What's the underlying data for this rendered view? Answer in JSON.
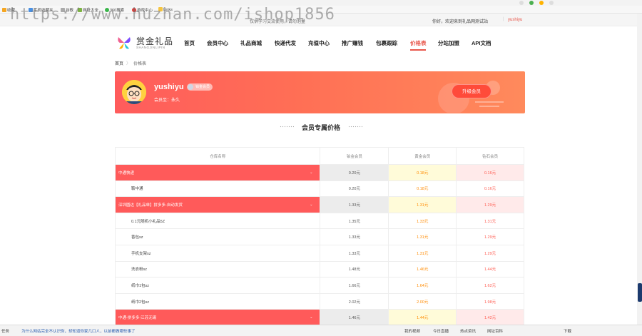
{
  "watermark": "https://www.huzhan.com/ishop1856",
  "bookmarks": [
    {
      "label": "收藏",
      "color": "#f5a623"
    },
    {
      "label": "手机收藏夹",
      "color": "#4a90e2"
    },
    {
      "label": "谷歌",
      "color": "#888888"
    },
    {
      "label": "网址大全",
      "color": "#7cb342"
    },
    {
      "label": "360搜索",
      "color": "#3ab54a"
    },
    {
      "label": "游戏中心",
      "color": "#e53935"
    },
    {
      "label": "Links",
      "color": "#f5c542"
    }
  ],
  "topbar": {
    "notice": "仅供学习交流使用，请勿泡量",
    "welcome": "你好，欢迎来到礼品网测试站",
    "separator": "|",
    "username": "yushiyu"
  },
  "header": {
    "logo_name": "赏金礼品",
    "logo_sub": "SHANGJINLIPIN",
    "nav": [
      "首页",
      "会员中心",
      "礼品商城",
      "快递代发",
      "充值中心",
      "推广赚钱",
      "包裹跟踪",
      "价格表",
      "分站加盟",
      "API文档"
    ],
    "active_nav": "价格表"
  },
  "breadcrumb": {
    "home": "首页",
    "sep": "〉",
    "current": "价格表"
  },
  "banner": {
    "username": "yushiyu",
    "badge": "铂金会员",
    "level_label": "会员至：永久",
    "upgrade_button": "升级会员"
  },
  "section_title": "会员专属价格",
  "table": {
    "headers": [
      "仓库名称",
      "铂金会员",
      "黄金会员",
      "钻石会员"
    ],
    "rows": [
      {
        "type": "group",
        "name": "中通快递",
        "silver": "0.20元",
        "gold": "0.18元",
        "diamond": "0.16元"
      },
      {
        "type": "item",
        "name": "鞍中通",
        "silver": "0.20元",
        "gold": "0.18元",
        "diamond": "0.16元"
      },
      {
        "type": "group",
        "name": "深圳圆达【礼品单】拼多多-自动发货",
        "silver": "1.33元",
        "gold": "1.31元",
        "diamond": "1.29元"
      },
      {
        "type": "item",
        "name": "0.1元随机小礼品5Z",
        "silver": "1.35元",
        "gold": "1.33元",
        "diamond": "1.31元"
      },
      {
        "type": "item",
        "name": "香包sz",
        "silver": "1.33元",
        "gold": "1.31元",
        "diamond": "1.29元"
      },
      {
        "type": "item",
        "name": "手机支架sz",
        "silver": "1.33元",
        "gold": "1.31元",
        "diamond": "1.29元"
      },
      {
        "type": "item",
        "name": "洗衣粉sz",
        "silver": "1.48元",
        "gold": "1.46元",
        "diamond": "1.44元"
      },
      {
        "type": "item",
        "name": "纸巾1包sz",
        "silver": "1.66元",
        "gold": "1.64元",
        "diamond": "1.62元"
      },
      {
        "type": "item",
        "name": "纸巾2包sz",
        "silver": "2.02元",
        "gold": "2.00元",
        "diamond": "1.98元"
      },
      {
        "type": "group",
        "name": "中通-拼多多-江苏无锡",
        "silver": "1.46元",
        "gold": "1.44元",
        "diamond": "1.42元"
      }
    ]
  },
  "statusbar": {
    "left": "任务",
    "hint": "为什么网站完全不认识你，却知道你家几口人，以前都做哪些事了",
    "items": [
      "我的视频",
      "今日直播",
      "热点资讯",
      "网址百科"
    ],
    "download": "下载"
  },
  "colors": {
    "accent": "#e8564a",
    "group_row": "#ff5a5a",
    "gold_text": "#ff8a00",
    "diamond_text": "#ff5a4f"
  }
}
